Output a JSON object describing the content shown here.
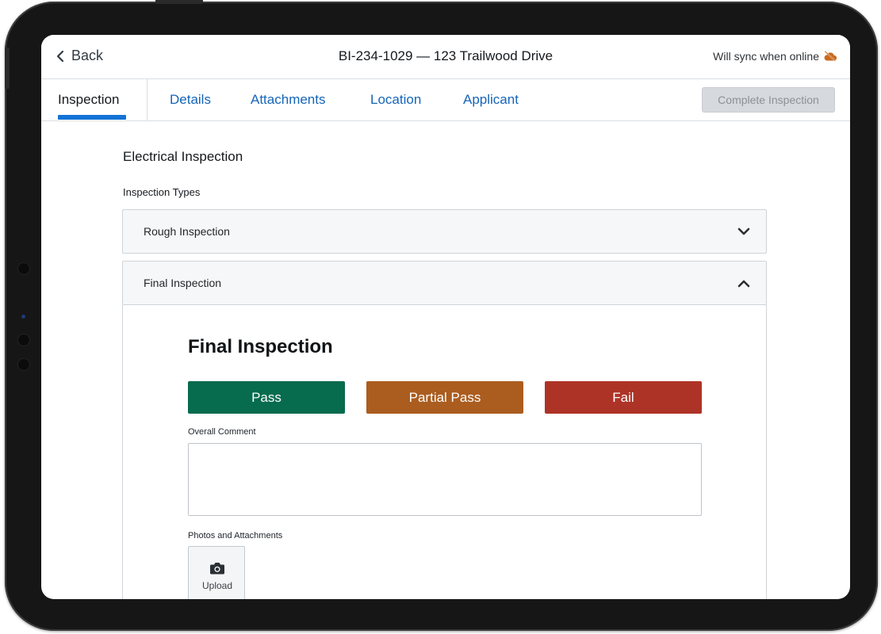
{
  "header": {
    "back_label": "Back",
    "title": "BI-234-1029 — 123 Trailwood Drive",
    "sync_status": "Will sync when online",
    "sync_icon": "cloud-off-icon"
  },
  "tabs": [
    {
      "label": "Inspection",
      "active": true
    },
    {
      "label": "Details",
      "active": false
    },
    {
      "label": "Attachments",
      "active": false
    },
    {
      "label": "Location",
      "active": false
    },
    {
      "label": "Applicant",
      "active": false
    }
  ],
  "complete_button": {
    "label": "Complete Inspection",
    "enabled": false
  },
  "main": {
    "section_title": "Electrical Inspection",
    "types_label": "Inspection Types",
    "accordion": [
      {
        "label": "Rough Inspection",
        "expanded": false
      },
      {
        "label": "Final Inspection",
        "expanded": true
      }
    ]
  },
  "final_panel": {
    "title": "Final Inspection",
    "buttons": {
      "pass": "Pass",
      "partial": "Partial Pass",
      "fail": "Fail"
    },
    "comment_label": "Overall Comment",
    "comment_value": "",
    "photos_label": "Photos and Attachments",
    "upload_label": "Upload"
  },
  "colors": {
    "accent": "#1373d6",
    "link": "#1565b8",
    "pass": "#076b4e",
    "partial": "#ab5d1f",
    "fail": "#ae3327",
    "sync_icon": "#c96a1e"
  }
}
